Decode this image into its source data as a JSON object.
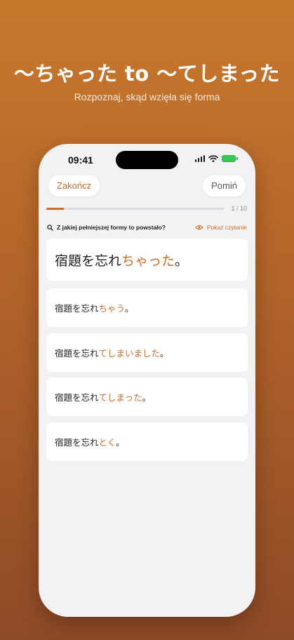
{
  "hero": {
    "title": "〜ちゃった to 〜てしまった",
    "subtitle": "Rozpoznaj, skąd wzięła się forma"
  },
  "status_bar": {
    "time": "09:41"
  },
  "nav": {
    "finish_label": "Zakończ",
    "skip_label": "Pomiń"
  },
  "progress": {
    "current": 1,
    "total": 10,
    "text": "1 / 10",
    "fraction": 0.1
  },
  "hint": {
    "question": "Z jakiej pełniejszej formy to powstało?",
    "show_reading": "Pokaż czytanie"
  },
  "question_card": {
    "base": "宿題を忘れ",
    "highlight": "ちゃった",
    "end": "。"
  },
  "options": [
    {
      "base": "宿題を忘れ",
      "highlight": "ちゃう",
      "end": "。"
    },
    {
      "base": "宿題を忘れ",
      "highlight": "てしまいました",
      "end": "。"
    },
    {
      "base": "宿題を忘れ",
      "highlight": "てしまった",
      "end": "。"
    },
    {
      "base": "宿題を忘れ",
      "highlight": "とく",
      "end": "。"
    }
  ],
  "colors": {
    "accent": "#c86e2c",
    "background_top": "#c8782c",
    "background_bottom": "#8e4a26"
  },
  "icons": {
    "search": "magnifier-icon",
    "eye": "eye-icon"
  }
}
